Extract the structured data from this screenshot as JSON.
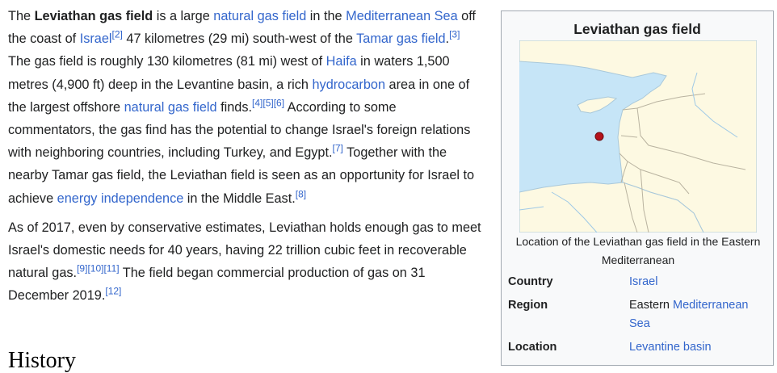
{
  "article": {
    "p1": {
      "t1": "The ",
      "b1": "Leviathan gas field",
      "t2": " is a large ",
      "l_natgas": "natural gas field",
      "t3": " in the ",
      "l_medsea": "Mediterranean Sea",
      "t4": " off the coast of ",
      "l_israel": "Israel",
      "r2": "[2]",
      "t5": " 47 kilometres (29 mi) south-west of the ",
      "l_tamar": "Tamar gas field",
      "t6": ".",
      "r3": "[3]",
      "t7": " The gas field is roughly 130 kilometres (81 mi) west of ",
      "l_haifa": "Haifa",
      "t8": " in waters 1,500 metres (4,900 ft) deep in the Levantine basin, a rich ",
      "l_hydro": "hydrocarbon",
      "t9": " area in one of the largest offshore ",
      "l_natgas2": "natural gas field",
      "t10": " finds.",
      "r4": "[4]",
      "r5": "[5]",
      "r6": "[6]",
      "t11": " According to some commentators, the gas find has the potential to change Israel's foreign relations with neighboring countries, including Turkey, and Egypt.",
      "r7": "[7]",
      "t12": " Together with the nearby Tamar gas field, the Leviathan field is seen as an opportunity for Israel to achieve ",
      "l_energy": "energy independence",
      "t13": " in the Middle East.",
      "r8": "[8]"
    },
    "p2": {
      "t1": "As of 2017, even by conservative estimates, Leviathan holds enough gas to meet Israel's domestic needs for 40 years, having 22 trillion cubic feet in recoverable natural gas.",
      "r9": "[9]",
      "r10": "[10]",
      "r11": "[11]",
      "t2": " The field began commercial production of gas on 31 December 2019.",
      "r12": "[12]"
    },
    "next_heading": "History"
  },
  "infobox": {
    "title": "Leviathan gas field",
    "map_icon": "location-map",
    "marker_color": "#b5121b",
    "sea_color": "#c6e5f7",
    "land_color": "#fdf9e2",
    "caption": "Location of the Leviathan gas field in the Eastern Mediterranean",
    "rows": [
      {
        "label": "Country",
        "value_link": "Israel"
      },
      {
        "label": "Region",
        "value_text": "Eastern ",
        "value_link": "Mediterranean Sea"
      },
      {
        "label": "Location",
        "value_link": "Levantine basin"
      }
    ]
  }
}
